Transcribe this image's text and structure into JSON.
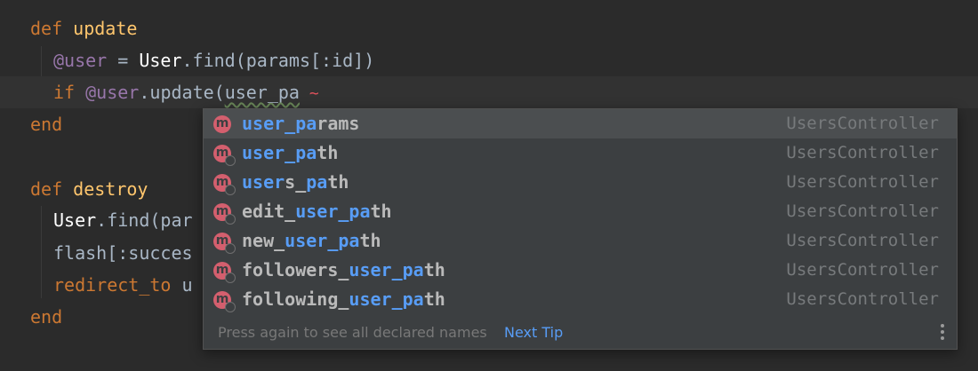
{
  "editor": {
    "lines": {
      "l1": {
        "kw": "def",
        "fn": "update"
      },
      "l2": {
        "ivar": "@user",
        "eq": " = ",
        "const": "User",
        "rest": ".find(params[:id])"
      },
      "l3": {
        "kw": "if",
        "ivar": "@user",
        "call": ".update(",
        "typed": "user_pa"
      },
      "l4": {
        "kw": "end"
      },
      "l6": {
        "kw": "def",
        "fn": "destroy"
      },
      "l7": {
        "const": "User",
        "rest": ".find(par"
      },
      "l8": {
        "text": "flash[:succes"
      },
      "l9": {
        "kw": "redirect_to",
        "rest": " u"
      },
      "l10": {
        "kw": "end"
      }
    }
  },
  "completion": {
    "items": [
      {
        "pre": "",
        "hl": "user_pa",
        "post": "rams",
        "type": "UsersController",
        "icon": "method-icon"
      },
      {
        "pre": "",
        "hl": "user_pa",
        "post": "th",
        "type": "UsersController",
        "icon": "method-globe-icon"
      },
      {
        "pre": "",
        "hl": "user",
        "mid": "s_",
        "hl2": "pa",
        "post": "th",
        "type": "UsersController",
        "icon": "method-globe-icon"
      },
      {
        "pre": "edit_",
        "hl": "user_pa",
        "post": "th",
        "type": "UsersController",
        "icon": "method-globe-icon"
      },
      {
        "pre": "new_",
        "hl": "user_pa",
        "post": "th",
        "type": "UsersController",
        "icon": "method-globe-icon"
      },
      {
        "pre": "followers_",
        "hl": "user_pa",
        "post": "th",
        "type": "UsersController",
        "icon": "method-globe-icon"
      },
      {
        "pre": "following_",
        "hl": "user_pa",
        "post": "th",
        "type": "UsersController",
        "icon": "method-globe-icon"
      }
    ],
    "icon_letter": "m",
    "footer_text": "Press again to see all declared names",
    "footer_link": "Next Tip"
  },
  "colors": {
    "background": "#2b2b2b",
    "keyword": "#cc7832",
    "function": "#ffc66d",
    "ivar": "#9876aa",
    "match_highlight": "#589df6",
    "popup_bg": "#3c3f41"
  }
}
